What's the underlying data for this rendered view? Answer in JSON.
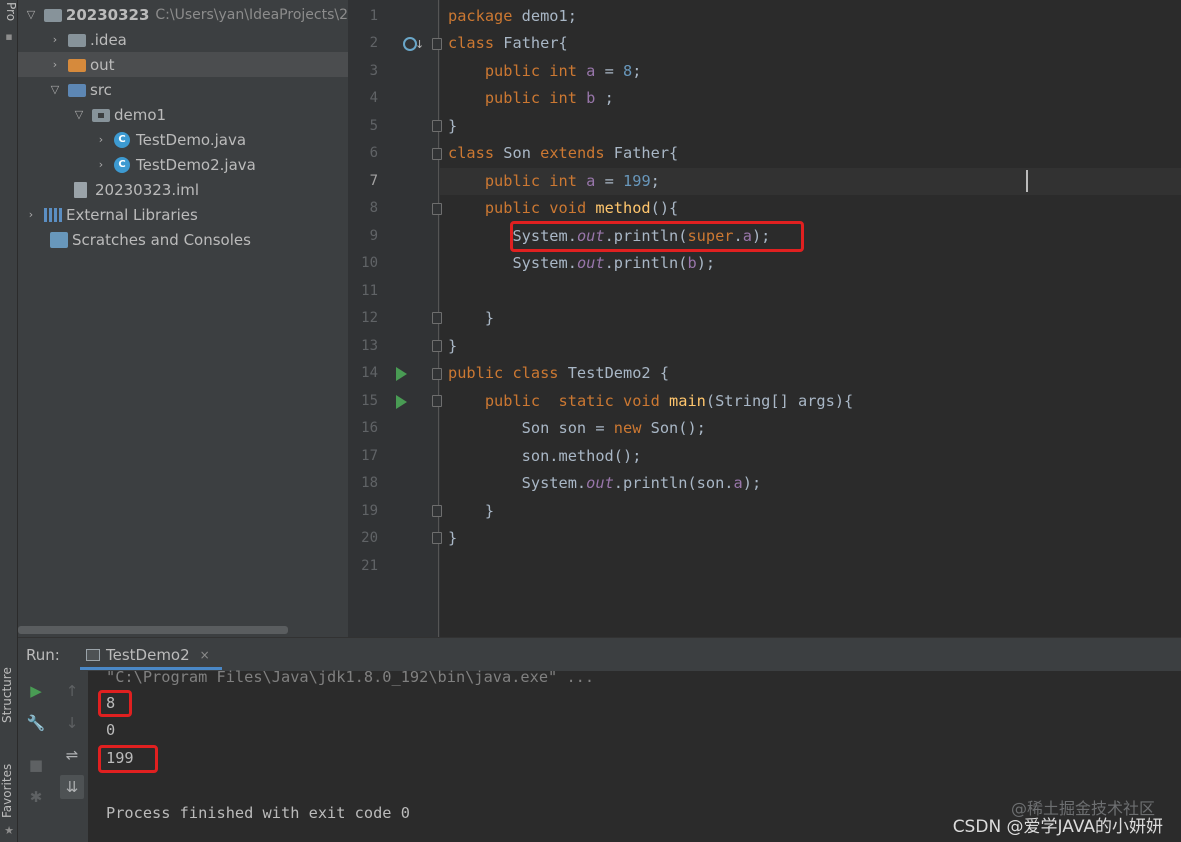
{
  "left_strip": {
    "project_tab": "Pro",
    "structure_tab": "Structure",
    "favorites_tab": "Favorites"
  },
  "project_tree": [
    {
      "label": "20230323",
      "hint": "C:\\Users\\yan\\IdeaProjects\\2",
      "bold": true
    },
    {
      "label": ".idea"
    },
    {
      "label": "out"
    },
    {
      "label": "src"
    },
    {
      "label": "demo1"
    },
    {
      "label": "TestDemo.java"
    },
    {
      "label": "TestDemo2.java"
    },
    {
      "label": "20230323.iml"
    },
    {
      "label": "External Libraries"
    },
    {
      "label": "Scratches and Consoles"
    }
  ],
  "editor": {
    "line_numbers": [
      "1",
      "2",
      "3",
      "4",
      "5",
      "6",
      "7",
      "8",
      "9",
      "10",
      "11",
      "12",
      "13",
      "14",
      "15",
      "16",
      "17",
      "18",
      "19",
      "20",
      "21"
    ],
    "current_line": "7"
  },
  "run_panel": {
    "label": "Run:",
    "tab_label": "TestDemo2",
    "tab_close": "×",
    "command_line": "\"C:\\Program Files\\Java\\jdk1.8.0_192\\bin\\java.exe\" ...",
    "output": [
      "8",
      "0",
      "199",
      "",
      "Process finished with exit code 0"
    ]
  },
  "icons": {
    "run": "play-icon",
    "wrench": "wrench-icon",
    "stop": "stop-icon",
    "up": "arrow-up-icon",
    "down": "arrow-down-icon",
    "wrap": "soft-wrap-icon",
    "scroll_end": "scroll-to-end-icon",
    "debug": "bug-icon"
  },
  "watermark": {
    "faint": "@稀土掘金技术社区",
    "main": "CSDN @爱学JAVA的小妍妍"
  },
  "colors": {
    "keyword": "#cc7832",
    "number": "#6897bb",
    "field": "#9876aa",
    "method": "#ffc66d",
    "highlight": "#e02020",
    "run_green": "#499c54"
  }
}
